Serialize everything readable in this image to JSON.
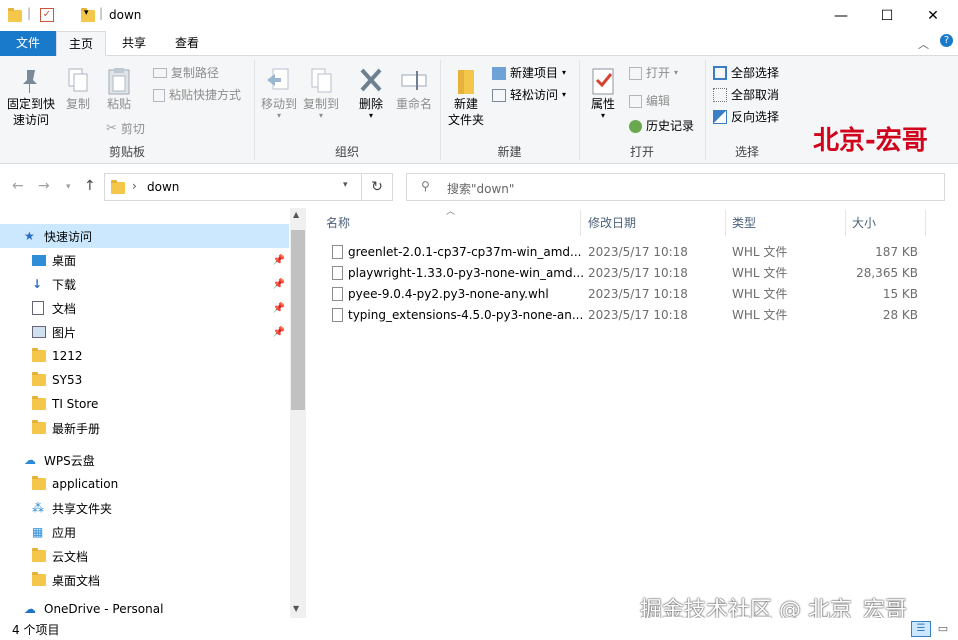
{
  "window": {
    "title": "down"
  },
  "tabs": [
    {
      "label": "文件"
    },
    {
      "label": "主页"
    },
    {
      "label": "共享"
    },
    {
      "label": "查看"
    }
  ],
  "ribbon": {
    "clipboard": {
      "pin_label": "固定到快速访问",
      "pin_line1": "固定到快",
      "pin_line2": "速访问",
      "copy": "复制",
      "paste": "粘贴",
      "copy_path": "复制路径",
      "paste_shortcut": "粘贴快捷方式",
      "cut": "剪切",
      "group": "剪贴板"
    },
    "organize": {
      "move_to": "移动到",
      "copy_to": "复制到",
      "delete": "删除",
      "rename": "重命名",
      "group": "组织"
    },
    "new": {
      "new_folder_line1": "新建",
      "new_folder_line2": "文件夹",
      "new_item": "新建项目",
      "easy_access": "轻松访问",
      "group": "新建"
    },
    "open": {
      "properties": "属性",
      "open": "打开",
      "edit": "编辑",
      "history": "历史记录",
      "group": "打开"
    },
    "select": {
      "select_all": "全部选择",
      "select_none": "全部取消",
      "invert": "反向选择",
      "group": "选择"
    }
  },
  "address": {
    "path": "down",
    "search_placeholder": "搜索\"down\""
  },
  "nav": {
    "items": [
      {
        "label": "快速访问",
        "icon": "star-icon"
      },
      {
        "label": "桌面",
        "icon": "desktop-icon"
      },
      {
        "label": "下载",
        "icon": "download-icon"
      },
      {
        "label": "文档",
        "icon": "document-icon"
      },
      {
        "label": "图片",
        "icon": "pictures-icon"
      },
      {
        "label": "1212",
        "icon": "folder-icon"
      },
      {
        "label": "SY53",
        "icon": "folder-icon"
      },
      {
        "label": "TI Store",
        "icon": "folder-icon"
      },
      {
        "label": "最新手册",
        "icon": "folder-icon"
      },
      {
        "label": "WPS云盘",
        "icon": "cloud-icon"
      },
      {
        "label": "application",
        "icon": "folder-icon"
      },
      {
        "label": "共享文件夹",
        "icon": "share-icon"
      },
      {
        "label": "应用",
        "icon": "apps-icon"
      },
      {
        "label": "云文档",
        "icon": "folder-icon"
      },
      {
        "label": "桌面文档",
        "icon": "folder-icon"
      },
      {
        "label": "OneDrive - Personal",
        "icon": "onedrive-icon"
      }
    ]
  },
  "columns": {
    "name": "名称",
    "date": "修改日期",
    "type": "类型",
    "size": "大小"
  },
  "files": [
    {
      "name": "greenlet-2.0.1-cp37-cp37m-win_amd...",
      "date": "2023/5/17 10:18",
      "type": "WHL 文件",
      "size": "187 KB"
    },
    {
      "name": "playwright-1.33.0-py3-none-win_amd...",
      "date": "2023/5/17 10:18",
      "type": "WHL 文件",
      "size": "28,365 KB"
    },
    {
      "name": "pyee-9.0.4-py2.py3-none-any.whl",
      "date": "2023/5/17 10:18",
      "type": "WHL 文件",
      "size": "15 KB"
    },
    {
      "name": "typing_extensions-4.5.0-py3-none-an...",
      "date": "2023/5/17 10:18",
      "type": "WHL 文件",
      "size": "28 KB"
    }
  ],
  "status": {
    "count": "4 个项目"
  },
  "watermark": {
    "top": "北京-宏哥",
    "bottom": "掘金技术社区 @ 北京_宏哥"
  },
  "colors": {
    "accent": "#1979ca",
    "selection": "#cce8ff",
    "watermark": "#d0021b"
  }
}
